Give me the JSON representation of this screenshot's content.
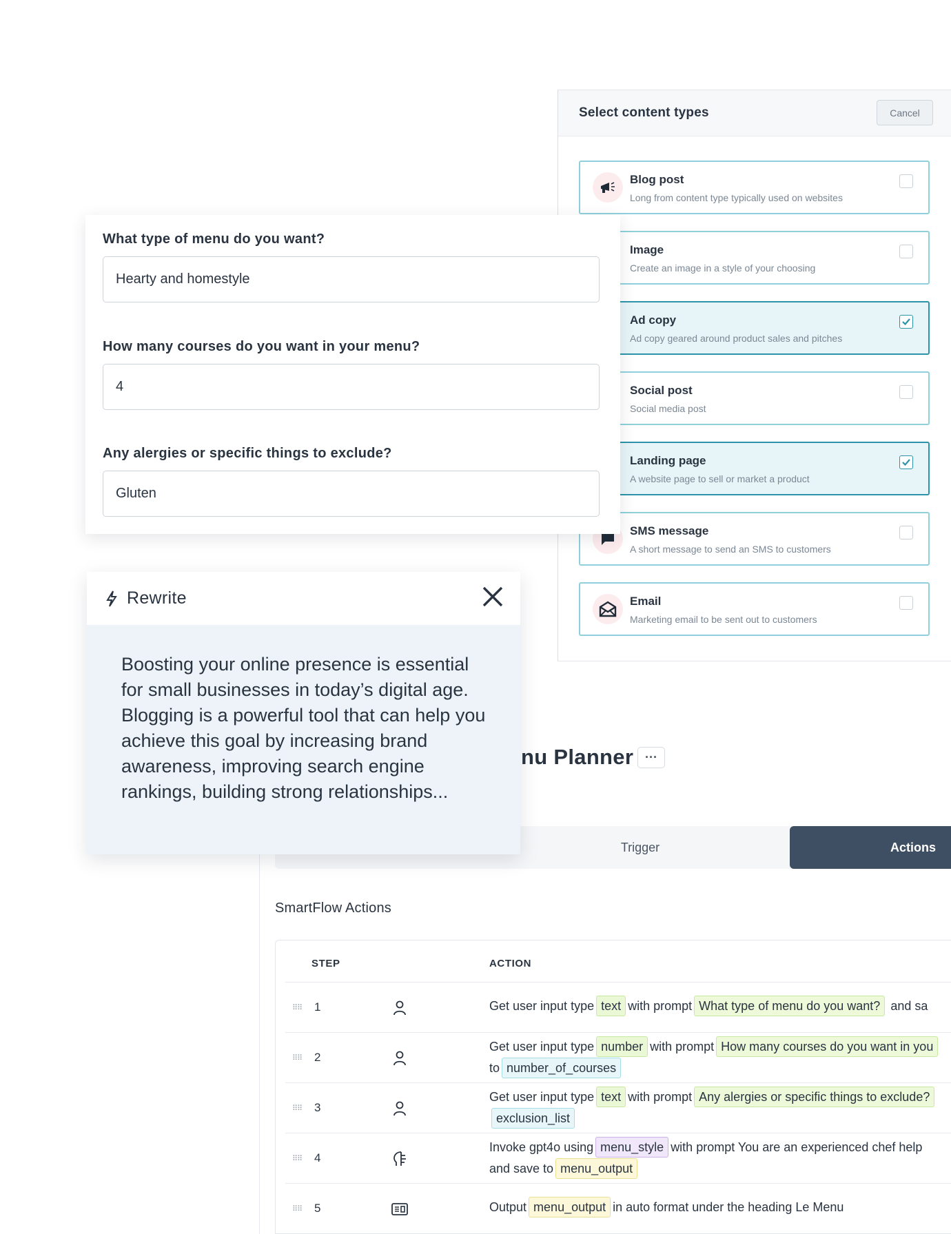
{
  "content_types": {
    "title": "Select content types",
    "cancel_label": "Cancel",
    "items": [
      {
        "name": "Blog post",
        "desc": "Long from content type typically used on websites",
        "icon": "megaphone-icon",
        "checked": false
      },
      {
        "name": "Image",
        "desc": "Create an image in a style of your choosing",
        "icon": "image-icon",
        "checked": false
      },
      {
        "name": "Ad copy",
        "desc": "Ad copy geared around product sales and pitches",
        "icon": "ad-icon",
        "checked": true
      },
      {
        "name": "Social post",
        "desc": "Social media post",
        "icon": "social-icon",
        "checked": false
      },
      {
        "name": "Landing page",
        "desc": "A website page to sell or market a product",
        "icon": "landing-icon",
        "checked": true
      },
      {
        "name": "SMS message",
        "desc": "A short message to send an SMS to customers",
        "icon": "chat-bubble-icon",
        "checked": false
      },
      {
        "name": "Email",
        "desc": "Marketing email to be sent out to customers",
        "icon": "envelope-icon",
        "checked": false
      }
    ]
  },
  "menu_form": {
    "fields": [
      {
        "label": "What type of menu do you want?",
        "value": "Hearty and homestyle"
      },
      {
        "label": "How many courses do you want in your menu?",
        "value": "4"
      },
      {
        "label": "Any alergies or specific things to exclude?",
        "value": "Gluten"
      }
    ]
  },
  "rewrite": {
    "title": "Rewrite",
    "text": "Boosting your online presence is essential for small businesses in today’s digital age. Blogging is a powerful tool that can help you achieve this goal by increasing brand awareness, improving search engine rankings, building strong relationships..."
  },
  "flow": {
    "title": "nu Planner",
    "more_label": "···",
    "tabs": {
      "trigger": "Trigger",
      "actions": "Actions"
    },
    "section_title": "SmartFlow Actions",
    "columns": {
      "step": "STEP",
      "action": "ACTION"
    },
    "rows": [
      {
        "step": "1",
        "icon": "user-icon",
        "line1": [
          "Get user input type",
          "text",
          "with prompt",
          "What type of menu do you want?",
          "and sa"
        ],
        "line2": []
      },
      {
        "step": "2",
        "icon": "user-icon",
        "line1": [
          "Get user input type",
          "number",
          "with prompt",
          "How many courses do you want in you"
        ],
        "line2": [
          "to",
          "number_of_courses"
        ]
      },
      {
        "step": "3",
        "icon": "user-icon",
        "line1": [
          "Get user input type",
          "text",
          "with prompt",
          "Any alergies or specific things to exclude?"
        ],
        "line2": [
          "exclusion_list"
        ]
      },
      {
        "step": "4",
        "icon": "ai-brain-icon",
        "line1": [
          "Invoke gpt4o using",
          "menu_style",
          "with prompt You are an experienced chef help"
        ],
        "line2": [
          "and save to",
          "menu_output"
        ]
      },
      {
        "step": "5",
        "icon": "output-icon",
        "line1": [
          "Output",
          "menu_output",
          "in auto format under the heading Le Menu"
        ],
        "line2": []
      }
    ]
  },
  "colors": {
    "accent": "#2d93a8",
    "dark_tab": "#3f4f63",
    "card_border": "#8fd0dc",
    "rewrite_bg": "#edf3f8"
  }
}
